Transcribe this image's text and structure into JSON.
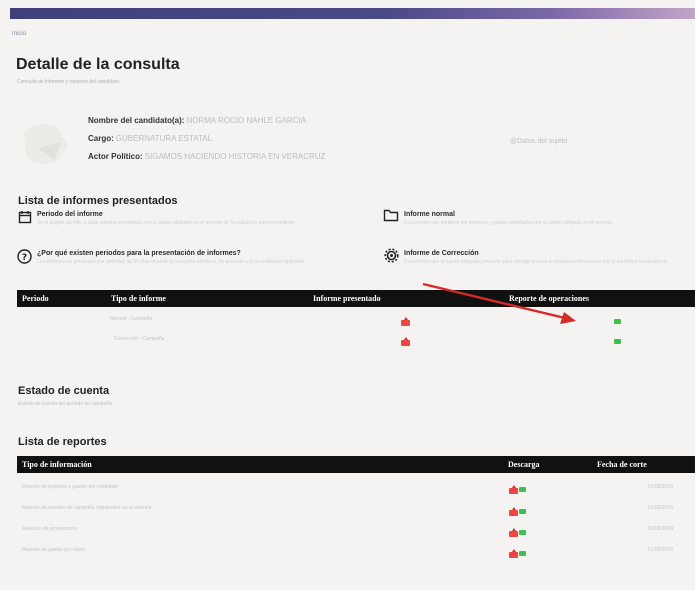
{
  "breadcrumb": "Inicio",
  "page": {
    "title": "Detalle de la consulta",
    "subtitle": "Consulta de informes y reportes del candidato"
  },
  "candidate": {
    "name_label": "Nombre del candidato(a):",
    "name_value": "NORMA ROCIO NAHLE GARCIA",
    "cargo_label": "Cargo:",
    "cargo_value": "GUBERNATURA ESTATAL",
    "actor_label": "Actor Político:",
    "actor_value": "SIGAMOS HACIENDO HISTORIA EN VERACRUZ",
    "right_link": "Datos del sujeto"
  },
  "informes": {
    "title": "Lista de informes presentados",
    "blocks": [
      {
        "title": "Periodo del informe",
        "text": "Se le asigna un folio a cada informe presentado por el sujeto obligado en el periodo de fiscalización correspondiente."
      },
      {
        "title": "Informe normal",
        "text": "Documento que contiene los ingresos y gastos reportados por el sujeto obligado en el periodo."
      },
      {
        "title": "¿Por qué existen periodos para la presentación de informes?",
        "text": "Los informes se presentan por periodos de 30 días durante la campaña electoral, de acuerdo a la normatividad aplicable."
      },
      {
        "title": "Informe de Corrección",
        "text": "Documento que el sujeto obligado presenta para corregir errores u omisiones detectados por la autoridad fiscalizadora."
      }
    ],
    "headers": [
      "Periodo",
      "Tipo de informe",
      "Informe presentado",
      "Reporte de operaciones"
    ],
    "rows": [
      {
        "tipo": "Normal - Campaña"
      },
      {
        "tipo": "Corrección - Campaña"
      }
    ]
  },
  "estado": {
    "title": "Estado de cuenta",
    "subtitle": "Estado de cuenta del periodo de campaña"
  },
  "reportes": {
    "title": "Lista de reportes",
    "headers": [
      "Tipo de información",
      "Descarga",
      "Fecha de corte"
    ],
    "rows": [
      {
        "tipo": "Reporte de ingresos y gastos del candidato",
        "fecha": "01/06/2024"
      },
      {
        "tipo": "Reporte de eventos de campaña registrados en el sistema",
        "fecha": "01/06/2024"
      },
      {
        "tipo": "Relación de proveedores",
        "fecha": "01/06/2024"
      },
      {
        "tipo": "Reporte de gastos por rubro",
        "fecha": "01/06/2024"
      }
    ]
  },
  "colors": {
    "header_bar": "#111111",
    "accent_gradient_start": "#3f3f7a",
    "pdf": "#e44444",
    "excel": "#3fbf4d",
    "arrow": "#d42a2a"
  }
}
